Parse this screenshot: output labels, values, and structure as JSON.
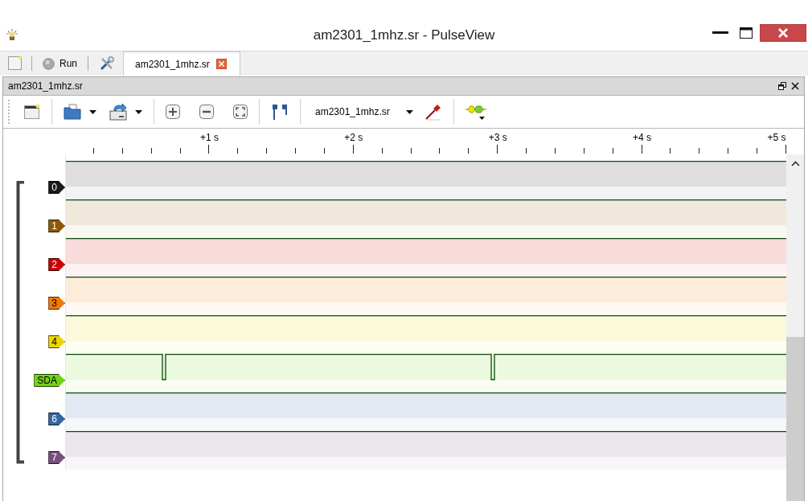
{
  "window": {
    "title": "am2301_1mhz.sr - PulseView"
  },
  "main_toolbar": {
    "run_label": "Run"
  },
  "tabs": [
    {
      "label": "am2301_1mhz.sr",
      "selected": true
    }
  ],
  "dock": {
    "title": "am2301_1mhz.sr"
  },
  "device": {
    "value": "am2301_1mhz.sr"
  },
  "ruler": {
    "labels": [
      "+1 s",
      "+2 s",
      "+3 s",
      "+4 s",
      "+5 s"
    ]
  },
  "channels": [
    {
      "name": "0",
      "color": "#1a1a1a",
      "kind": "flat"
    },
    {
      "name": "1",
      "color": "#8f5902",
      "kind": "flat"
    },
    {
      "name": "2",
      "color": "#cc0000",
      "kind": "flat"
    },
    {
      "name": "3",
      "color": "#f57900",
      "kind": "flat"
    },
    {
      "name": "4",
      "color": "#edd400",
      "kind": "flat"
    },
    {
      "name": "SDA",
      "color": "#73d216",
      "kind": "pulsed"
    },
    {
      "name": "6",
      "color": "#3465a4",
      "kind": "flat"
    },
    {
      "name": "7",
      "color": "#75507b",
      "kind": "flat"
    }
  ]
}
